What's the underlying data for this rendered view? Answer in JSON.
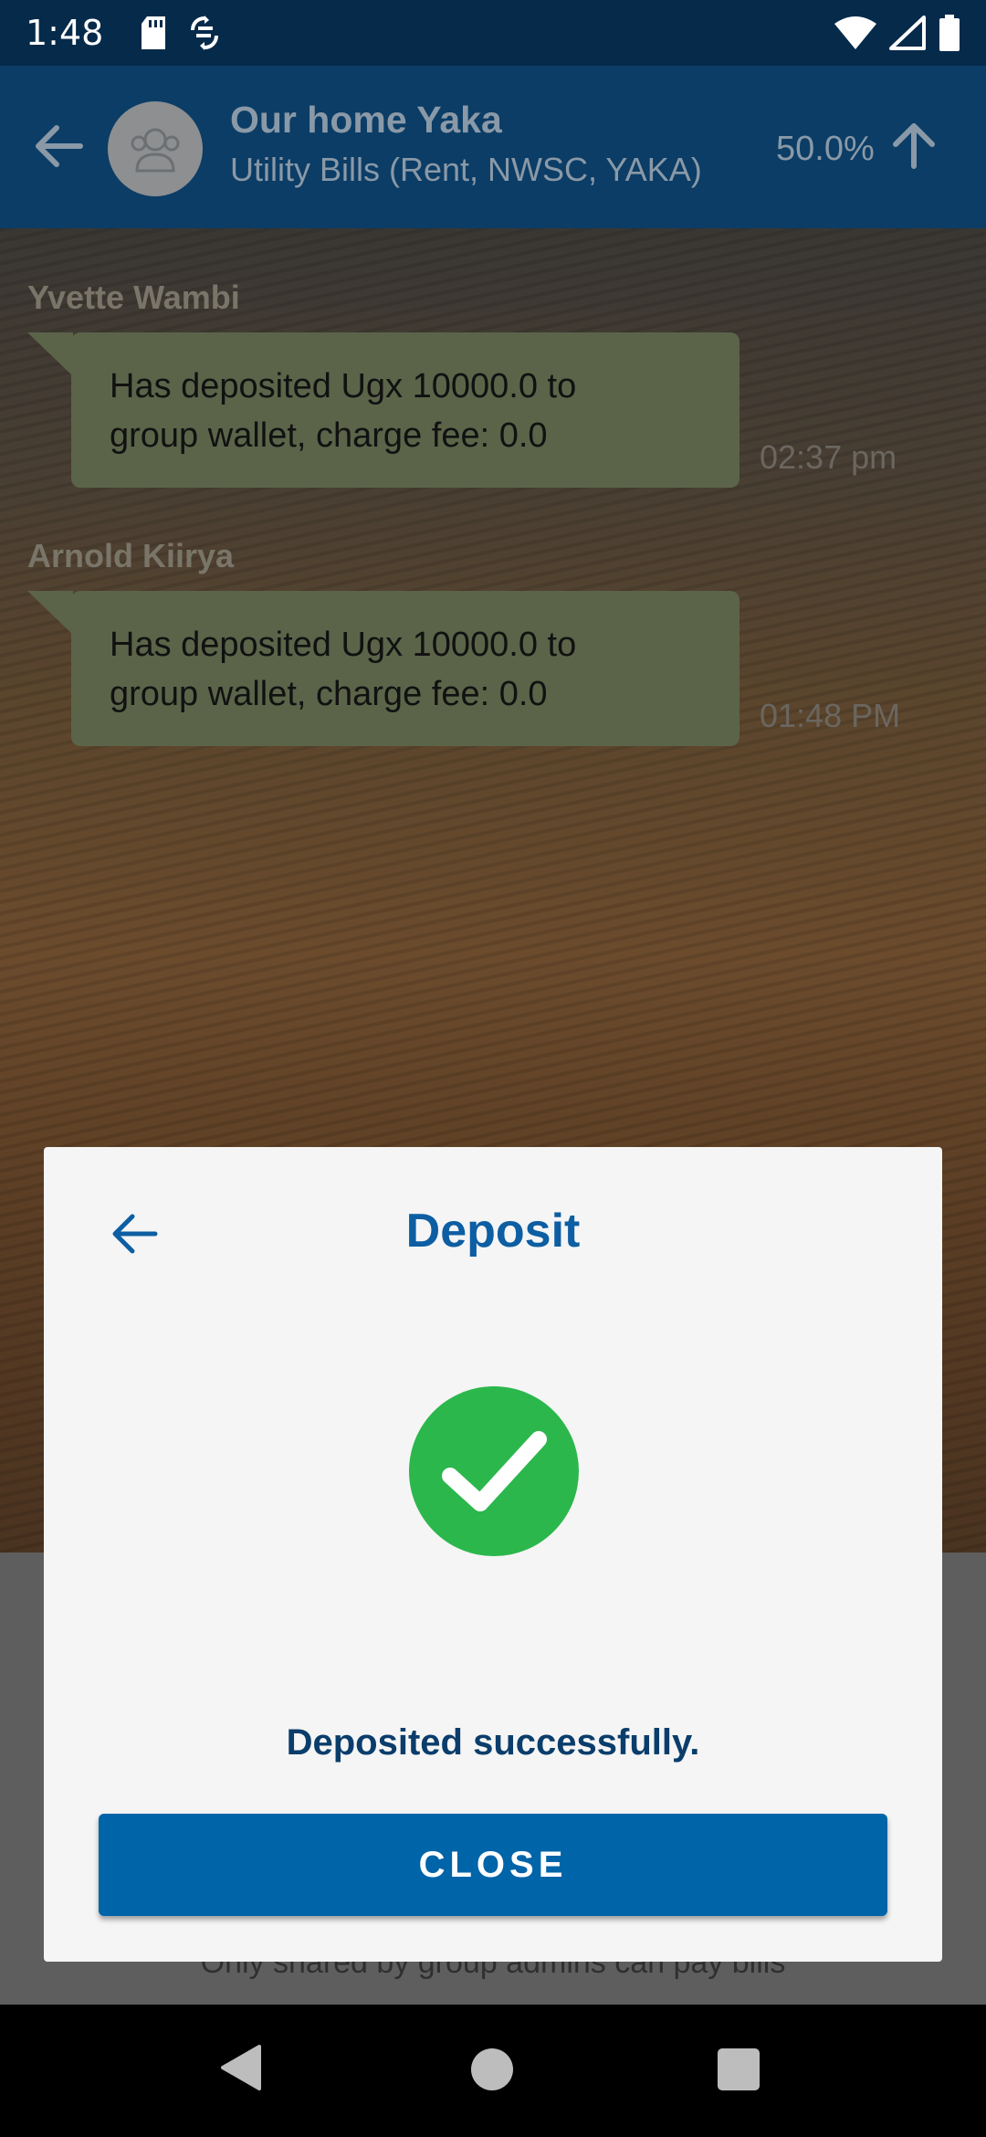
{
  "status_bar": {
    "time": "1:48"
  },
  "header": {
    "title": "Our home Yaka",
    "subtitle": "Utility Bills (Rent, NWSC, YAKA)",
    "progress": "50.0%"
  },
  "messages": [
    {
      "sender": "Yvette  Wambi",
      "text_line1": "Has deposited Ugx 10000.0 to",
      "text_line2": "group wallet, charge fee: 0.0",
      "time": "02:37 pm"
    },
    {
      "sender": "Arnold Kiirya",
      "text_line1": "Has deposited Ugx 10000.0 to",
      "text_line2": "group wallet, charge fee: 0.0",
      "time": "01:48 PM"
    }
  ],
  "background_note": "Only shared by group admins can pay bills",
  "dialog": {
    "title": "Deposit",
    "message": "Deposited successfully.",
    "close_label": "CLOSE"
  },
  "colors": {
    "brand_blue": "#0064a8",
    "success_green": "#2bb74c",
    "header_bg": "#0b3d66"
  },
  "icons": {
    "sd_card": "sd-card-icon",
    "sync": "sync-icon",
    "wifi": "wifi-icon",
    "signal": "signal-icon",
    "battery": "battery-icon"
  }
}
